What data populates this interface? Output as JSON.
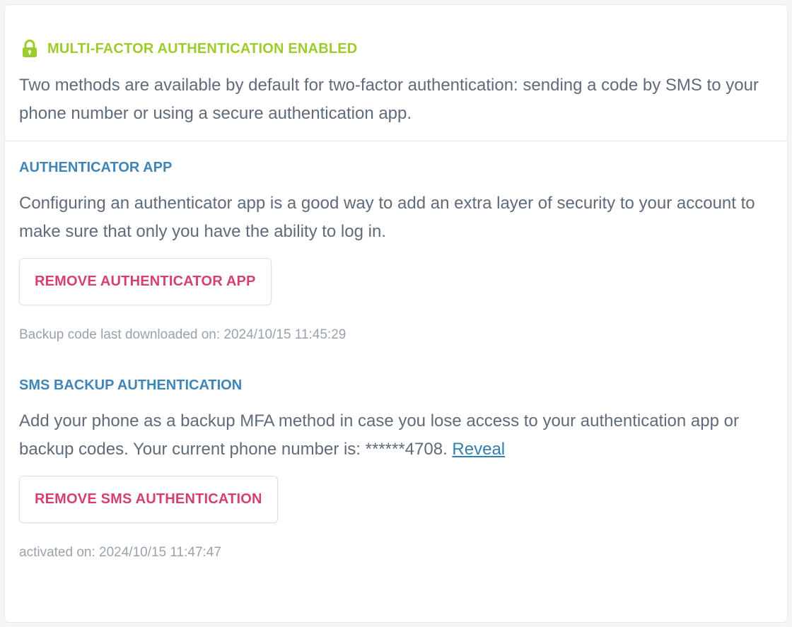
{
  "status": {
    "icon": "lock-icon",
    "text": "MULTI-FACTOR AUTHENTICATION ENABLED"
  },
  "intro": "Two methods are available by default for two-factor authentication: sending a code by SMS to your phone number or using a secure authentication app.",
  "authenticator": {
    "title": "AUTHENTICATOR APP",
    "description": "Configuring an authenticator app is a good way to add an extra layer of security to your account to make sure that only you have the ability to log in.",
    "button_label": "REMOVE AUTHENTICATOR APP",
    "meta": "Backup code last downloaded on: 2024/10/15 11:45:29"
  },
  "sms": {
    "title": "SMS BACKUP AUTHENTICATION",
    "description_prefix": "Add your phone as a backup MFA method in case you lose access to your authentication app or backup codes. Your current phone number is: ******4708. ",
    "reveal_label": "Reveal",
    "button_label": "REMOVE SMS AUTHENTICATION",
    "meta": "activated on: 2024/10/15 11:47:47"
  },
  "colors": {
    "status_green": "#9ccc2c",
    "section_blue": "#3f85b8",
    "danger_pink": "#d63f76",
    "link_blue": "#2f7fb0"
  }
}
